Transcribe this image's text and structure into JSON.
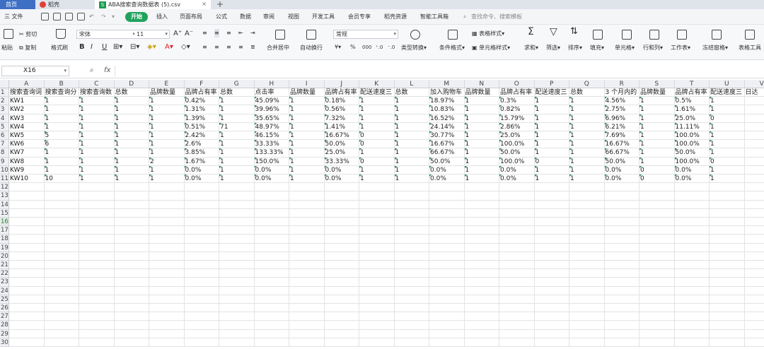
{
  "tabs": {
    "home": "首页",
    "daoke": "稻壳",
    "file": "ABA搜索查询数据表 (5).csv",
    "add": "+"
  },
  "menu": {
    "file": "三 文件",
    "start": "开始",
    "items": [
      "插入",
      "页面布局",
      "公式",
      "数据",
      "审阅",
      "视图",
      "开发工具",
      "会员专享",
      "稻壳资源",
      "智能工具箱"
    ],
    "search_placeholder": "查找命令、搜索模板"
  },
  "ribbon": {
    "paste": "粘贴",
    "cut": "剪切",
    "copy": "复制",
    "format_painter": "格式刷",
    "font_name": "宋体",
    "font_size": "11",
    "number_format": "常规",
    "merge": "合并居中",
    "wrap": "自动换行",
    "type_convert": "类型转换",
    "cond_format": "条件格式",
    "table_style": "表格样式",
    "cell_style": "单元格样式",
    "sum": "求和",
    "filter": "筛选",
    "sort": "排序",
    "fill": "填充",
    "cell": "单元格",
    "row_col": "行和列",
    "sheet": "工作表",
    "freeze": "冻结窗格",
    "table_tools": "表格工具"
  },
  "formula_bar": {
    "name_box": "X16",
    "fx": "fx",
    "content": ""
  },
  "grid": {
    "columns": [
      "A",
      "B",
      "C",
      "D",
      "E",
      "F",
      "G",
      "H",
      "I",
      "J",
      "K",
      "L",
      "M",
      "N",
      "O",
      "P",
      "Q",
      "R",
      "S",
      "T",
      "U",
      "V"
    ],
    "row_numbers": [
      "1",
      "2",
      "3",
      "4",
      "5",
      "6",
      "7",
      "8",
      "9",
      "10",
      "11",
      "12",
      "13",
      "14",
      "15",
      "16",
      "17",
      "18",
      "19",
      "20",
      "21",
      "22",
      "23",
      "24",
      "25",
      "26",
      "27",
      "28",
      "29",
      "30"
    ],
    "selected_row": "16",
    "header_row": [
      "搜索查询词",
      "搜索查询分",
      "搜索查询数",
      "总数",
      "品牌数量",
      "品牌占有率",
      "总数",
      "点击率",
      "品牌数量",
      "品牌占有率",
      "配送速度三",
      "总数",
      "加入购物车",
      "品牌数量",
      "品牌占有率",
      "配送速度三",
      "总数",
      "3 个月内的",
      "品牌数量",
      "品牌占有率",
      "配送速度三",
      "日达"
    ],
    "rows": [
      [
        "KW1",
        "1",
        "1",
        "1",
        "1",
        "0.42%",
        "1",
        "45.09%",
        "1",
        "0.18%",
        "1",
        "1",
        "18.97%",
        "1",
        "0.3%",
        "1",
        "1",
        "4.56%",
        "1",
        "0.5%",
        "1",
        ""
      ],
      [
        "KW2",
        "1",
        "1",
        "1",
        "1",
        "1.31%",
        "1",
        "39.96%",
        "1",
        "0.56%",
        "1",
        "1",
        "10.83%",
        "1",
        "0.82%",
        "1",
        "1",
        "2.75%",
        "1",
        "1.61%",
        "1",
        ""
      ],
      [
        "KW3",
        "1",
        "1",
        "1",
        "1",
        "1.39%",
        "1",
        "35.65%",
        "1",
        "7.32%",
        "1",
        "1",
        "16.52%",
        "1",
        "15.79%",
        "1",
        "1",
        "6.96%",
        "1",
        "25.0%",
        "0",
        ""
      ],
      [
        "KW4",
        "1",
        "1",
        "1",
        "1",
        "0.51%",
        "71",
        "48.97%",
        "1",
        "1.41%",
        "1",
        "1",
        "24.14%",
        "1",
        "2.86%",
        "1",
        "1",
        "6.21%",
        "1",
        "11.11%",
        "1",
        ""
      ],
      [
        "KW5",
        "5",
        "1",
        "1",
        "1",
        "2.42%",
        "1",
        "46.15%",
        "1",
        "16.67%",
        "0",
        "1",
        "30.77%",
        "1",
        "25.0%",
        "1",
        "1",
        "7.69%",
        "1",
        "100.0%",
        "1",
        ""
      ],
      [
        "KW6",
        "6",
        "1",
        "1",
        "1",
        "2.6%",
        "1",
        "33.33%",
        "1",
        "50.0%",
        "0",
        "1",
        "16.67%",
        "1",
        "100.0%",
        "1",
        "1",
        "16.67%",
        "1",
        "100.0%",
        "1",
        ""
      ],
      [
        "KW7",
        "1",
        "1",
        "1",
        "1",
        "3.85%",
        "1",
        "133.33%",
        "1",
        "25.0%",
        "1",
        "1",
        "66.67%",
        "1",
        "50.0%",
        "1",
        "1",
        "66.67%",
        "1",
        "50.0%",
        "1",
        ""
      ],
      [
        "KW8",
        "1",
        "1",
        "1",
        "2",
        "1.67%",
        "1",
        "150.0%",
        "1",
        "33.33%",
        "0",
        "1",
        "50.0%",
        "1",
        "100.0%",
        "0",
        "1",
        "50.0%",
        "1",
        "100.0%",
        "0",
        ""
      ],
      [
        "KW9",
        "1",
        "1",
        "1",
        "1",
        "0.0%",
        "1",
        "0.0%",
        "1",
        "0.0%",
        "1",
        "1",
        "0.0%",
        "1",
        "0.0%",
        "1",
        "1",
        "0.0%",
        "0",
        "0.0%",
        "1",
        ""
      ],
      [
        "KW10",
        "10",
        "1",
        "1",
        "1",
        "0.0%",
        "1",
        "0.0%",
        "1",
        "0.0%",
        "1",
        "1",
        "0.0%",
        "1",
        "0.0%",
        "1",
        "1",
        "0.0%",
        "0",
        "0.0%",
        "1",
        ""
      ]
    ]
  }
}
